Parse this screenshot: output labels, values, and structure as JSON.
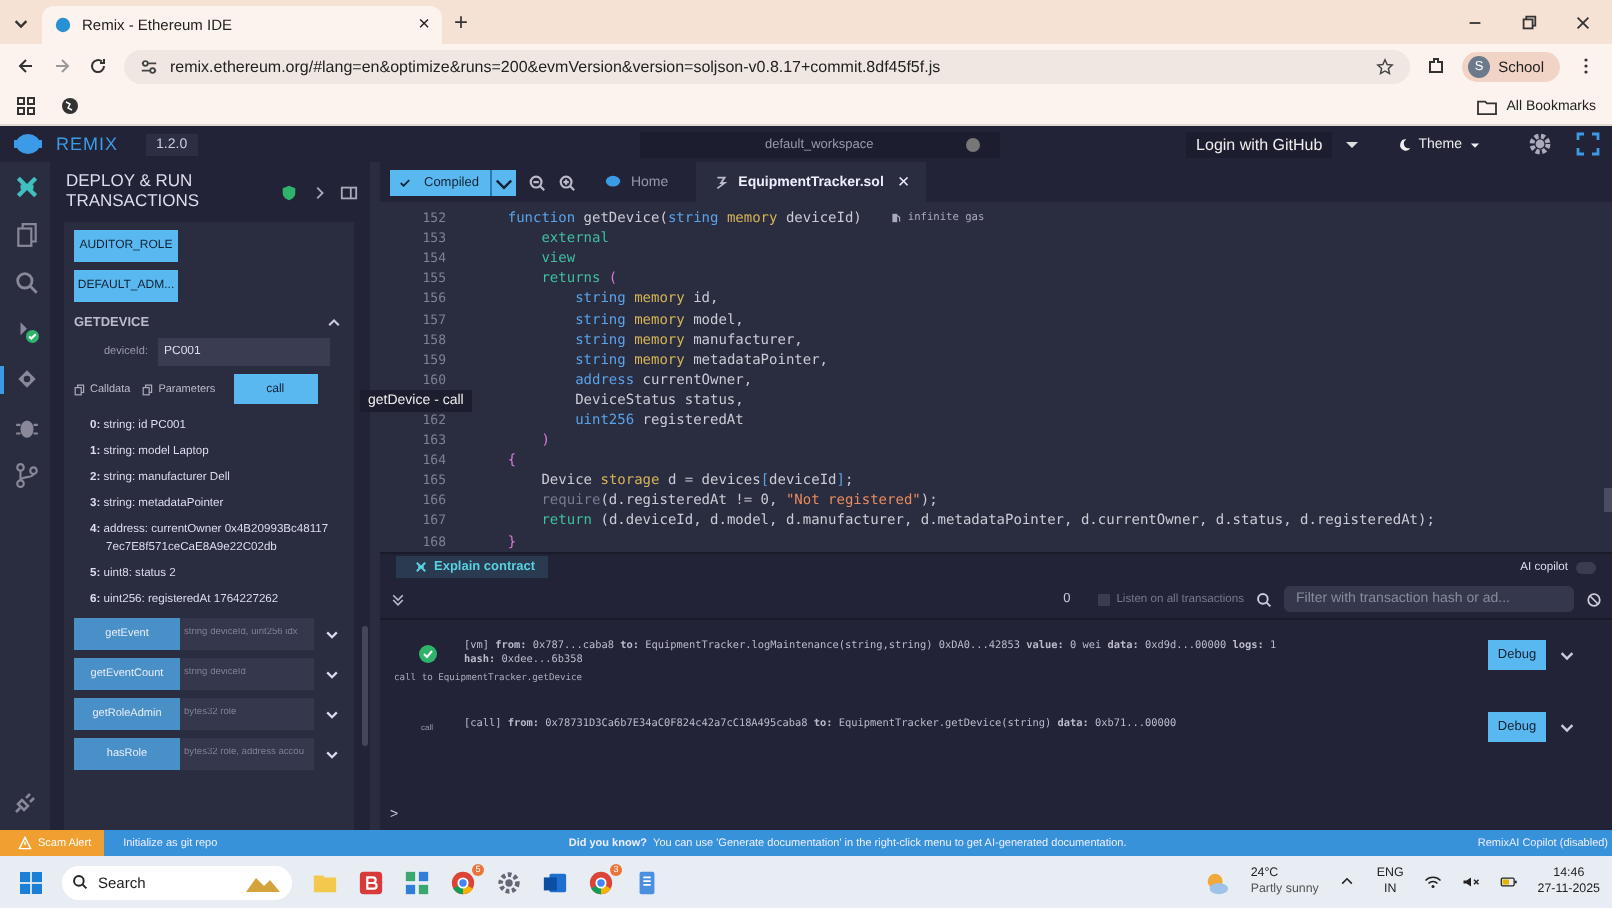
{
  "browser": {
    "tab_title": "Remix - Ethereum IDE",
    "close": "×",
    "new_tab": "+",
    "url": "remix.ethereum.org/#lang=en&optimize&runs=200&evmVersion&version=soljson-v0.8.17+commit.8df45f5f.js",
    "profile_initial": "S",
    "profile": "School",
    "bookmarks": "All Bookmarks"
  },
  "remix_bar": {
    "logo": "REMIX",
    "version": "1.2.0",
    "workspace": "default_workspace",
    "login": "Login with GitHub",
    "theme": "Theme"
  },
  "icon_rail": [
    {
      "kind": "logo",
      "selected": false
    },
    {
      "kind": "files",
      "selected": false
    },
    {
      "kind": "search",
      "selected": false
    },
    {
      "kind": "compiler",
      "selected": false
    },
    {
      "kind": "deploy",
      "selected": true
    },
    {
      "kind": "debugger",
      "selected": false
    },
    {
      "kind": "git",
      "selected": false
    }
  ],
  "side_panel": {
    "title": "DEPLOY & RUN TRANSACTIONS",
    "role_buttons": [
      "AUDITOR_ROLE",
      "DEFAULT_ADM..."
    ],
    "section": {
      "title": "GETDEVICE",
      "expanded": true
    },
    "param": {
      "label": "deviceId:",
      "value": "PC001"
    },
    "calldata": "Calldata",
    "parameters": "Parameters",
    "call": "call",
    "results": [
      "**0:** string: id PC001",
      "**1:** string: model Laptop",
      "**2:** string: manufacturer Dell",
      "**3:** string: metadataPointer",
      "**4:** address: currentOwner 0x4B20993Bc481177ec7E8f571ceCaE8A9e22C02db",
      "**5:** uint8: status 2",
      "**6:** uint256: registeredAt 1764227262"
    ],
    "functions": [
      {
        "name": "getEvent",
        "placeholder": "string deviceId, uint256 idx"
      },
      {
        "name": "getEventCount",
        "placeholder": "string deviceId"
      },
      {
        "name": "getRoleAdmin",
        "placeholder": "bytes32 role"
      },
      {
        "name": "hasRole",
        "placeholder": "bytes32 role, address accou"
      }
    ]
  },
  "tooltip": "getDevice - call",
  "editor": {
    "compile": "Compiled",
    "tabs": [
      {
        "label": "Home",
        "kind": "home",
        "selected": false
      },
      {
        "label": "EquipmentTracker.sol",
        "kind": "file",
        "selected": true,
        "close": "×"
      }
    ],
    "lines": [
      {
        "number": "152",
        "hint": "infinite gas",
        "tokens": [
          {
            "text": "    function",
            "kind": "kw"
          },
          {
            "text": " getDevice(",
            "kind": "plain"
          },
          {
            "text": "string",
            "kind": "kw"
          },
          {
            "text": " memory",
            "kind": "mem"
          },
          {
            "text": " deviceId)",
            "kind": "plain"
          }
        ]
      },
      {
        "number": "153",
        "tokens": [
          {
            "text": "        external",
            "kind": "mod"
          }
        ]
      },
      {
        "number": "154",
        "tokens": [
          {
            "text": "        view",
            "kind": "mod"
          }
        ]
      },
      {
        "number": "155",
        "tokens": [
          {
            "text": "        returns",
            "kind": "mod"
          },
          {
            "text": " (",
            "kind": "paren"
          }
        ]
      },
      {
        "number": "156",
        "tokens": [
          {
            "text": "            string",
            "kind": "kw"
          },
          {
            "text": " memory",
            "kind": "mem"
          },
          {
            "text": " id,",
            "kind": "plain"
          }
        ]
      },
      {
        "number": "157",
        "tokens": [
          {
            "text": "            string",
            "kind": "kw"
          },
          {
            "text": " memory",
            "kind": "mem"
          },
          {
            "text": " model,",
            "kind": "plain"
          }
        ]
      },
      {
        "number": "158",
        "tokens": [
          {
            "text": "            string",
            "kind": "kw"
          },
          {
            "text": " memory",
            "kind": "mem"
          },
          {
            "text": " manufacturer,",
            "kind": "plain"
          }
        ]
      },
      {
        "number": "159",
        "tokens": [
          {
            "text": "            string",
            "kind": "kw"
          },
          {
            "text": " memory",
            "kind": "mem"
          },
          {
            "text": " metadataPointer,",
            "kind": "plain"
          }
        ]
      },
      {
        "number": "160",
        "tokens": [
          {
            "text": "            address",
            "kind": "kw"
          },
          {
            "text": " currentOwner,",
            "kind": "plain"
          }
        ]
      },
      {
        "tokens": [
          {
            "text": "            DeviceStatus status,",
            "kind": "plain"
          }
        ]
      },
      {
        "number": "162",
        "tokens": [
          {
            "text": "            uint256",
            "kind": "kw"
          },
          {
            "text": " registeredAt",
            "kind": "plain"
          }
        ]
      },
      {
        "number": "163",
        "tokens": [
          {
            "text": "        )",
            "kind": "paren"
          }
        ]
      },
      {
        "number": "164",
        "tokens": [
          {
            "text": "    {",
            "kind": "paren"
          }
        ]
      },
      {
        "number": "165",
        "tokens": [
          {
            "text": "        Device",
            "kind": "plain"
          },
          {
            "text": " storage",
            "kind": "mem"
          },
          {
            "text": " d = devices",
            "kind": "plain"
          },
          {
            "text": "[",
            "kind": "kw"
          },
          {
            "text": "deviceId",
            "kind": "plain"
          },
          {
            "text": "]",
            "kind": "kw"
          },
          {
            "text": ";",
            "kind": "plain"
          }
        ]
      },
      {
        "number": "166",
        "tokens": [
          {
            "text": "        require",
            "kind": "muted"
          },
          {
            "text": "(d.registeredAt != 0, ",
            "kind": "plain"
          },
          {
            "text": "\"Not registered\"",
            "kind": "str"
          },
          {
            "text": ");",
            "kind": "plain"
          }
        ]
      },
      {
        "number": "167",
        "tokens": [
          {
            "text": "        return",
            "kind": "mod"
          },
          {
            "text": " (d.deviceId, d.model, d.manufacturer, d.metadataPointer, d.currentOwner, d.status, d.registeredAt);",
            "kind": "plain"
          }
        ]
      },
      {
        "number": "168",
        "tokens": [
          {
            "text": "    }",
            "kind": "paren"
          }
        ]
      }
    ]
  },
  "terminal": {
    "explain": "Explain contract",
    "ai_copilot": {
      "label": "AI copilot",
      "on": false
    },
    "count": "0",
    "listen": {
      "label": "Listen on all transactions",
      "checked": false
    },
    "filter_placeholder": "Filter with transaction hash or ad...",
    "entries": [
      {
        "kind": "success",
        "text": "[vm] **from:** 0x787...caba8 **to:** EquipmentTracker.logMaintenance(string,string) 0xDA0...42853 **value:** 0 wei **data:** 0xd9d...00000 **logs:** 1",
        "hash": "**hash:** 0xdee...6b358",
        "debug": "Debug",
        "note": "call to EquipmentTracker.getDevice"
      },
      {
        "kind": "call",
        "badge": "call",
        "text": "[call] **from:** 0x78731D3Ca6b7E34aC0F824c42a7cC18A495caba8 **to:** EquipmentTracker.getDevice(string) **data:** 0xb71...00000",
        "debug": "Debug"
      }
    ],
    "prompt": ">"
  },
  "status_bar": {
    "alert": "Scam Alert",
    "git": "Initialize as git repo",
    "tip_title": "Did you know?",
    "tip": "You can use 'Generate documentation' in the right-click menu to get AI-generated documentation.",
    "copilot": "RemixAI Copilot (disabled)"
  },
  "taskbar": {
    "search": "Search",
    "apps": [
      {
        "kind": "files"
      },
      {
        "kind": "b"
      },
      {
        "kind": "tiles"
      },
      {
        "kind": "chrome",
        "badge": "5"
      },
      {
        "kind": "gear"
      },
      {
        "kind": "mail"
      },
      {
        "kind": "chrome",
        "badge": "3"
      },
      {
        "kind": "notes"
      }
    ],
    "temp": "24°C",
    "weather": "Partly sunny",
    "lang": "ENG",
    "region": "IN",
    "time": "14:46",
    "date": "27-11-2025"
  }
}
